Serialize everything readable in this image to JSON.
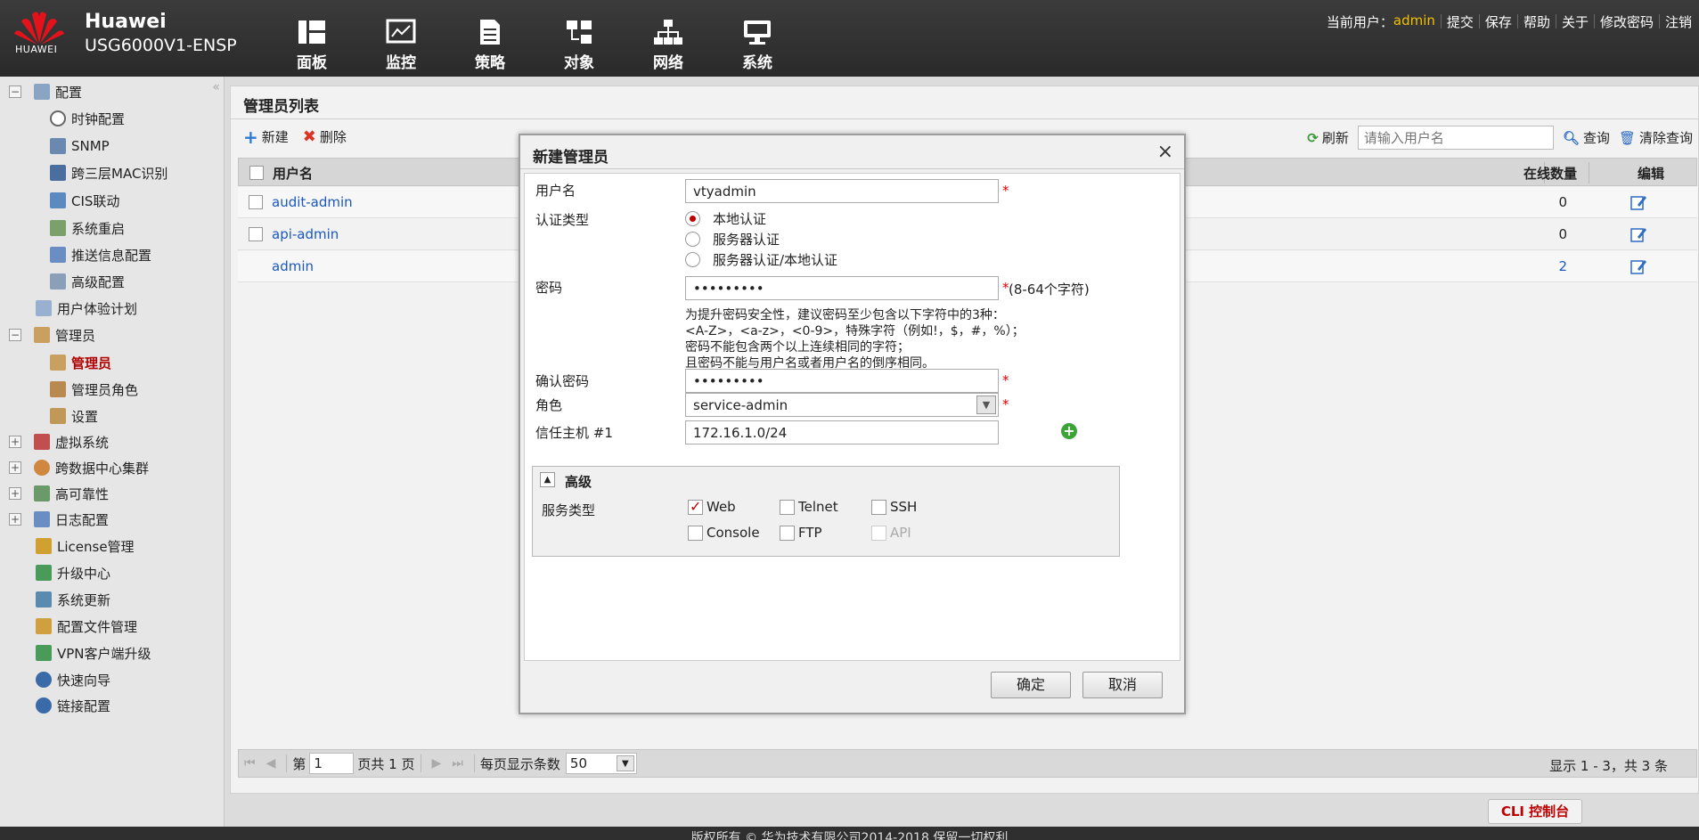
{
  "header": {
    "brand": "Huawei",
    "model": "USG6000V1-ENSP",
    "logo_text": "HUAWEI",
    "nav": [
      {
        "label": "面板",
        "icon": "dashboard-icon"
      },
      {
        "label": "监控",
        "icon": "monitor-icon"
      },
      {
        "label": "策略",
        "icon": "policy-icon"
      },
      {
        "label": "对象",
        "icon": "object-icon"
      },
      {
        "label": "网络",
        "icon": "network-icon"
      },
      {
        "label": "系统",
        "icon": "system-icon"
      }
    ],
    "current_user_label": "当前用户：",
    "current_user": "admin",
    "links": [
      "提交",
      "保存",
      "帮助",
      "关于",
      "修改密码",
      "注销"
    ]
  },
  "sidebar": {
    "collapse_symbol": "«",
    "items": [
      {
        "label": "配置",
        "level": 0,
        "expander": "−"
      },
      {
        "label": "时钟配置",
        "level": 1
      },
      {
        "label": "SNMP",
        "level": 1
      },
      {
        "label": "跨三层MAC识别",
        "level": 1
      },
      {
        "label": "CIS联动",
        "level": 1
      },
      {
        "label": "系统重启",
        "level": 1
      },
      {
        "label": "推送信息配置",
        "level": 1
      },
      {
        "label": "高级配置",
        "level": 1
      },
      {
        "label": "用户体验计划",
        "level": 0
      },
      {
        "label": "管理员",
        "level": 0,
        "expander": "−"
      },
      {
        "label": "管理员",
        "level": 1,
        "selected": true
      },
      {
        "label": "管理员角色",
        "level": 1
      },
      {
        "label": "设置",
        "level": 1
      },
      {
        "label": "虚拟系统",
        "level": 0,
        "expander": "+"
      },
      {
        "label": "跨数据中心集群",
        "level": 0,
        "expander": "+"
      },
      {
        "label": "高可靠性",
        "level": 0,
        "expander": "+"
      },
      {
        "label": "日志配置",
        "level": 0,
        "expander": "+"
      },
      {
        "label": "License管理",
        "level": 0
      },
      {
        "label": "升级中心",
        "level": 0
      },
      {
        "label": "系统更新",
        "level": 0
      },
      {
        "label": "配置文件管理",
        "level": 0
      },
      {
        "label": "VPN客户端升级",
        "level": 0
      },
      {
        "label": "快速向导",
        "level": 0
      },
      {
        "label": "链接配置",
        "level": 0
      }
    ]
  },
  "main": {
    "title": "管理员列表",
    "toolbar": {
      "new_label": "新建",
      "delete_label": "删除"
    },
    "refresh_label": "刷新",
    "search_placeholder": "请输入用户名",
    "query_label": "查询",
    "clear_label": "清除查询",
    "columns": {
      "username": "用户名",
      "online": "在线数量",
      "edit": "编辑"
    },
    "rows": [
      {
        "username": "audit-admin",
        "online": "0"
      },
      {
        "username": "api-admin",
        "online": "0"
      },
      {
        "username": "admin",
        "online": "2"
      }
    ],
    "pager": {
      "first": "⏮",
      "prev": "◀",
      "next": "▶",
      "last": "⏭",
      "page_prefix": "第",
      "page_value": "1",
      "page_suffix": "页共 1 页",
      "per_page_label": "每页显示条数",
      "per_page_value": "50",
      "summary": "显示 1 - 3，共 3 条"
    }
  },
  "cli_button": "CLI 控制台",
  "footer": "版权所有 © 华为技术有限公司2014-2018 保留一切权利",
  "modal": {
    "title": "新建管理员",
    "close": "×",
    "username_label": "用户名",
    "username_value": "vtyadmin",
    "auth_label": "认证类型",
    "auth_options": [
      "本地认证",
      "服务器认证",
      "服务器认证/本地认证"
    ],
    "auth_selected": "本地认证",
    "password_label": "密码",
    "password_value": "•••••••••",
    "password_hint_req": "(8-64个字符)",
    "password_hints": [
      "为提升密码安全性，建议密码至少包含以下字符中的3种：",
      "<A-Z>，<a-z>，<0-9>，特殊字符（例如!，$，#，%）；",
      "密码不能包含两个以上连续相同的字符；",
      "且密码不能与用户名或者用户名的倒序相同。"
    ],
    "confirm_label": "确认密码",
    "confirm_value": "•••••••••",
    "role_label": "角色",
    "role_value": "service-admin",
    "trusted_host_label": "信任主机 #1",
    "trusted_host_value": "172.16.1.0/24",
    "required_mark": "*",
    "advanced_title": "高级",
    "service_label": "服务类型",
    "services": [
      {
        "label": "Web",
        "checked": true,
        "disabled": false
      },
      {
        "label": "Telnet",
        "checked": false,
        "disabled": false
      },
      {
        "label": "SSH",
        "checked": false,
        "disabled": false
      },
      {
        "label": "Console",
        "checked": false,
        "disabled": false
      },
      {
        "label": "FTP",
        "checked": false,
        "disabled": false
      },
      {
        "label": "API",
        "checked": false,
        "disabled": true
      }
    ],
    "ok_label": "确定",
    "cancel_label": "取消"
  },
  "colors": {
    "accent_red": "#c00000",
    "link_blue": "#1a57c0",
    "user_yellow": "#f0c000",
    "header_bg": "#2f2f2f"
  }
}
